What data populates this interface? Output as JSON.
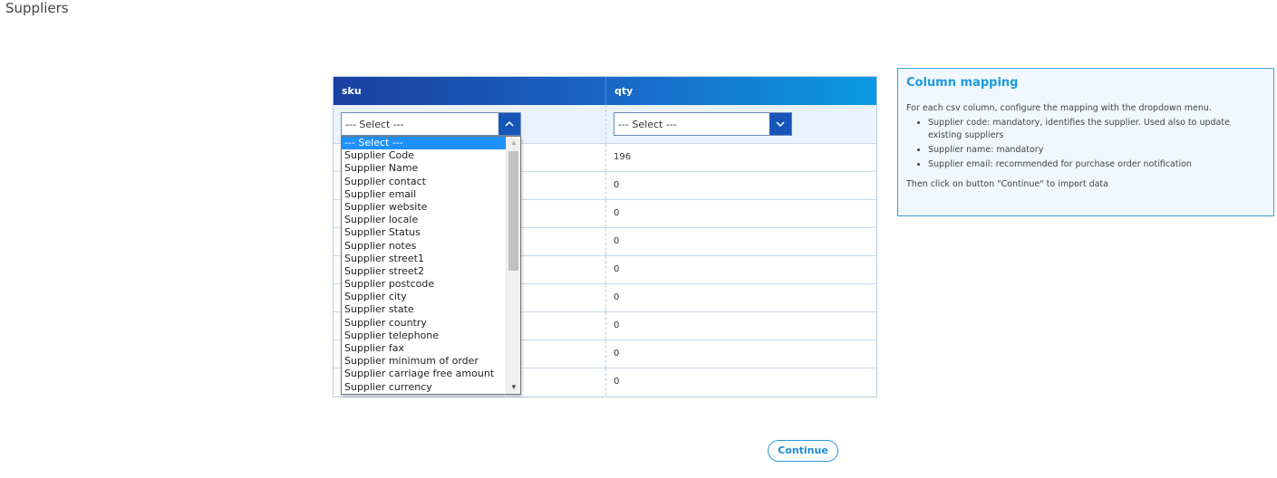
{
  "page": {
    "title": "Suppliers"
  },
  "table": {
    "headers": [
      "sku",
      "qty"
    ],
    "selects": {
      "sku": {
        "value": "--- Select ---",
        "open": true
      },
      "qty": {
        "value": "--- Select ---"
      }
    },
    "rows": [
      {
        "sku": "",
        "qty": "196"
      },
      {
        "sku": "",
        "qty": "0"
      },
      {
        "sku": "",
        "qty": "0"
      },
      {
        "sku": "",
        "qty": "0"
      },
      {
        "sku": "",
        "qty": "0"
      },
      {
        "sku": "",
        "qty": "0"
      },
      {
        "sku": "",
        "qty": "0"
      },
      {
        "sku": "",
        "qty": "0"
      },
      {
        "sku": "",
        "qty": "0"
      }
    ]
  },
  "dropdown": {
    "options": [
      "--- Select ---",
      "Supplier Code",
      "Supplier Name",
      "Supplier contact",
      "Supplier email",
      "Supplier website",
      "Supplier locale",
      "Supplier Status",
      "Supplier notes",
      "Supplier street1",
      "Supplier street2",
      "Supplier postcode",
      "Supplier city",
      "Supplier state",
      "Supplier country",
      "Supplier telephone",
      "Supplier fax",
      "Supplier minimum of order",
      "Supplier carriage free amount",
      "Supplier currency"
    ],
    "selected_index": 0
  },
  "info": {
    "title": "Column mapping",
    "intro": "For each csv column, configure the mapping with the dropdown menu.",
    "bullets": [
      "Supplier code: mandatory, identifies the supplier. Used also to update existing suppliers",
      "Supplier name: mandatory",
      "Supplier email: recommended for purchase order notification"
    ],
    "outro": "Then click on button \"Continue\" to import data"
  },
  "actions": {
    "continue_label": "Continue"
  },
  "colors": {
    "accent": "#1a9be0",
    "header_start": "#1a3fa0",
    "header_end": "#0a9ae2",
    "selected_option": "#1e90ff"
  }
}
